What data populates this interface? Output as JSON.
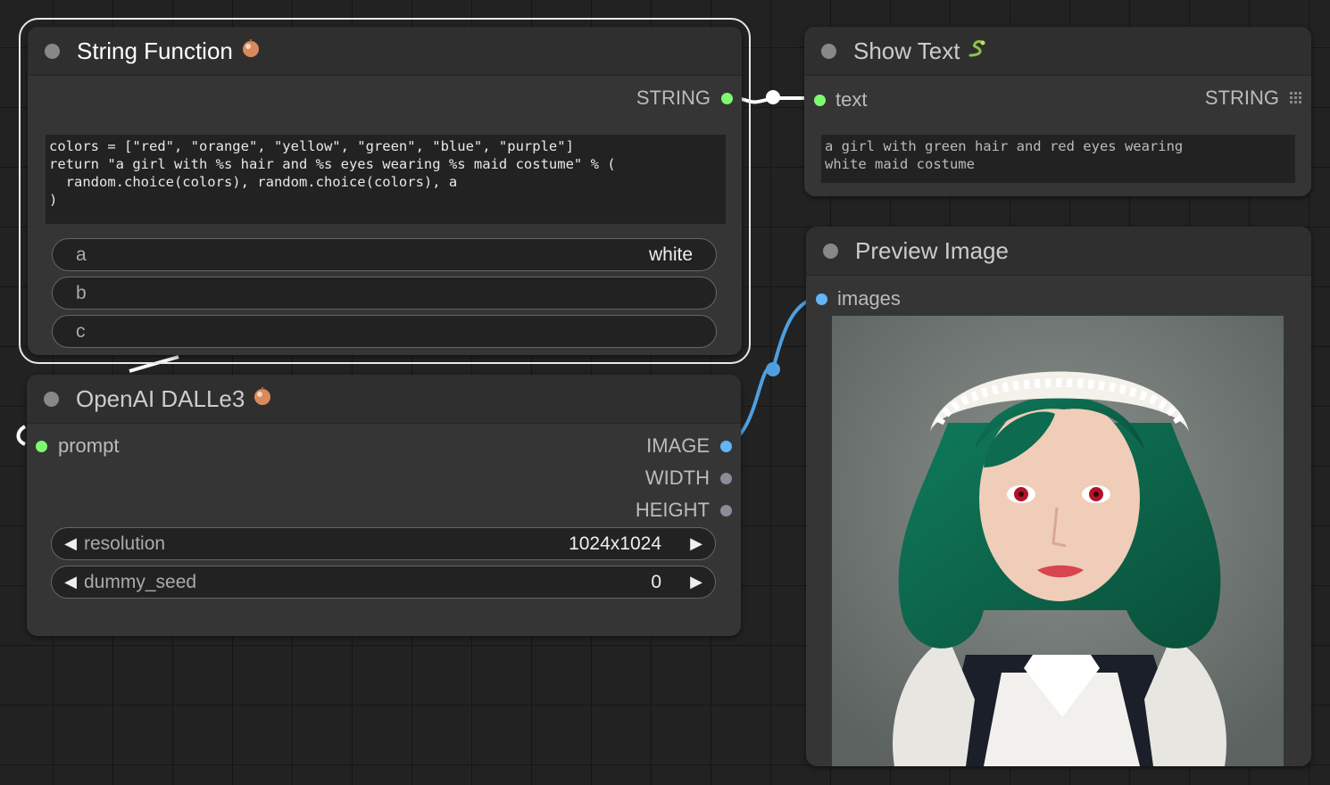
{
  "nodes": {
    "string_function": {
      "title": "String Function",
      "title_icon": "onion-icon",
      "output_label": "STRING",
      "code_lines": [
        "colors = [\"red\", \"orange\", \"yellow\", \"green\", \"blue\", \"purple\"]",
        "return \"a girl with %s hair and %s eyes wearing %s maid costume\" % (",
        "  random.choice(colors), random.choice(colors), a",
        ")"
      ],
      "inputs": [
        {
          "label": "a",
          "value": "white"
        },
        {
          "label": "b",
          "value": ""
        },
        {
          "label": "c",
          "value": ""
        }
      ]
    },
    "show_text": {
      "title": "Show Text",
      "title_icon": "snake-icon",
      "input_label": "text",
      "output_label": "STRING",
      "output_icon": "grid-icon",
      "text": "a girl with green hair and red eyes wearing\nwhite maid costume"
    },
    "preview_image": {
      "title": "Preview Image",
      "input_label": "images",
      "image_alt": "portrait of a girl with green wavy hair, red eyes, and a white maid costume with lace headpiece"
    },
    "dalle": {
      "title": "OpenAI DALLe3",
      "title_icon": "onion-icon",
      "input_label": "prompt",
      "outputs": [
        "IMAGE",
        "WIDTH",
        "HEIGHT"
      ],
      "widgets": [
        {
          "label": "resolution",
          "value": "1024x1024"
        },
        {
          "label": "dummy_seed",
          "value": "0"
        }
      ]
    }
  },
  "colors": {
    "string_slot": "#7dfa6e",
    "image_slot": "#64b5f6",
    "int_slot": "#8b8b9b",
    "link_image": "#4f9fe0",
    "link_string": "#ffffff"
  }
}
